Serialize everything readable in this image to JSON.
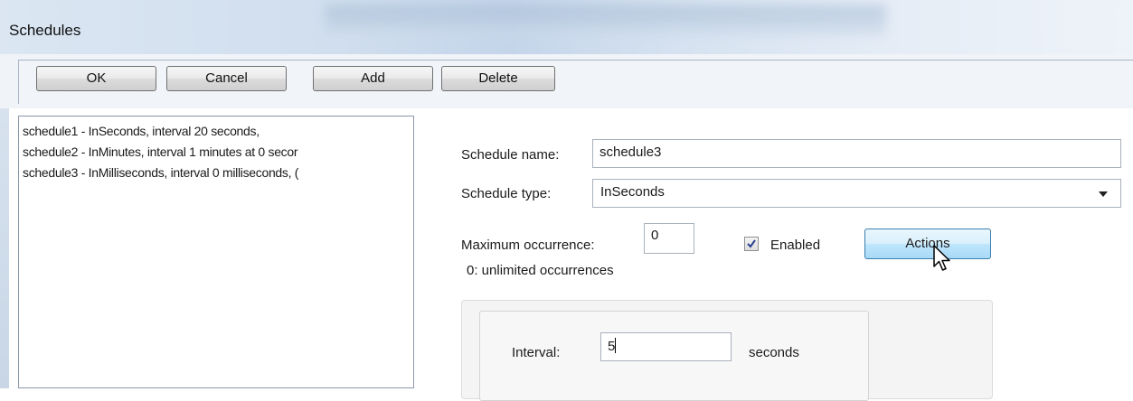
{
  "window": {
    "title": "Schedules"
  },
  "toolbar": {
    "ok_label": "OK",
    "cancel_label": "Cancel",
    "add_label": "Add",
    "delete_label": "Delete"
  },
  "schedule_list": {
    "items": [
      {
        "text": "schedule1 - InSeconds, interval 20 seconds,"
      },
      {
        "text": "schedule2 - InMinutes, interval 1 minutes at 0 secor"
      },
      {
        "text": "schedule3 - InMilliseconds, interval 0 milliseconds, ("
      }
    ]
  },
  "form": {
    "schedule_name_label": "Schedule name:",
    "schedule_name_value": "schedule3",
    "schedule_type_label": "Schedule type:",
    "schedule_type_value": "InSeconds",
    "max_occurrence_label": "Maximum occurrence:",
    "max_occurrence_value": "0",
    "occurrence_hint": "0: unlimited occurrences",
    "enabled_label": "Enabled",
    "enabled_checked": true,
    "actions_label": "Actions",
    "interval_label": "Interval:",
    "interval_value": "5",
    "interval_unit": "seconds"
  },
  "icons": {
    "check": "check-icon",
    "dropdown": "chevron-down-icon",
    "cursor": "mouse-pointer-icon"
  },
  "colors": {
    "titlebar": "#d0deee",
    "actions_hover": "#bee6fd",
    "actions_border": "#3c7fb1"
  }
}
